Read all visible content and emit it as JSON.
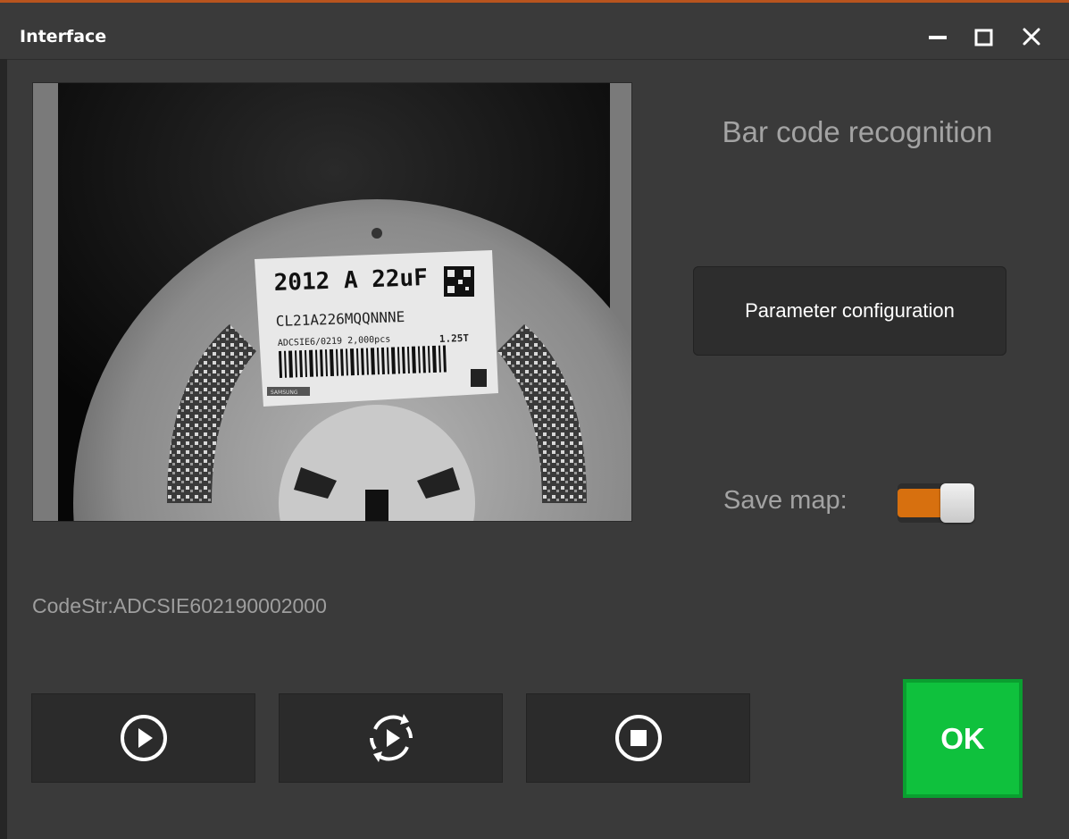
{
  "window": {
    "title": "Interface",
    "accent_color": "#b8541e",
    "controls": [
      "minimize-icon",
      "maximize-icon",
      "close-icon"
    ]
  },
  "camera_label": {
    "line1": "2012 A  22uF",
    "line2": "CL21A226MQQNNNE",
    "line3": "ADCSIE6/0219 2,000pcs",
    "line4": "1.25T",
    "brand": "SAMSUNG"
  },
  "panel": {
    "heading": "Bar code recognition",
    "param_button": "Parameter configuration",
    "save_map_label": "Save map:",
    "save_map_on": true,
    "toggle_color": "#d7700f"
  },
  "result": {
    "code_str": "CodeStr:ADCSIE602190002000"
  },
  "controls": [
    {
      "icon": "play-icon"
    },
    {
      "icon": "loop-play-icon"
    },
    {
      "icon": "stop-icon"
    }
  ],
  "ok_button": {
    "label": "OK",
    "color": "#0fc13d"
  }
}
